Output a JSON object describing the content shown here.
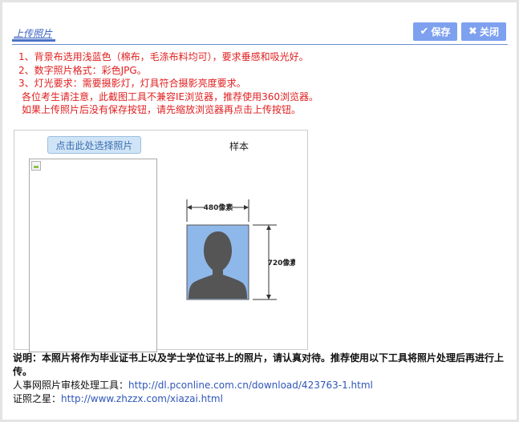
{
  "header": {
    "title": "上传照片",
    "save_label": "保存",
    "close_label": "关闭"
  },
  "notes": [
    "1、背景布选用浅蓝色（棉布，毛涤布料均可），要求垂感和吸光好。",
    "2、数字照片格式：彩色JPG。",
    "3、灯光要求：需要摄影灯，灯具符合摄影亮度要求。",
    "各位考生请注意，此截图工具不兼容IE浏览器，推荐使用360浏览器。",
    "如果上传照片后没有保存按钮，请先缩放浏览器再点击上传按钮。"
  ],
  "photo": {
    "select_label": "点击此处选择照片",
    "sample_label": "样本",
    "width_label": "480像素",
    "height_label": "720像素"
  },
  "footer": {
    "note": "说明：本照片将作为毕业证书上以及学士学位证书上的照片，请认真对待。推荐使用以下工具将照片处理后再进行上传。",
    "tool1_label": "人事网照片审核处理工具：",
    "tool1_url": "http://dl.pconline.com.cn/download/423763-1.html",
    "tool2_label": "证照之星：",
    "tool2_url": "http://www.zhzzx.com/xiazai.html"
  },
  "colors": {
    "accent": "#7ea1ef",
    "notes": "#e02020",
    "link": "#2f56b8",
    "sample_bg": "#8fb8ea",
    "silhouette": "#555555"
  }
}
